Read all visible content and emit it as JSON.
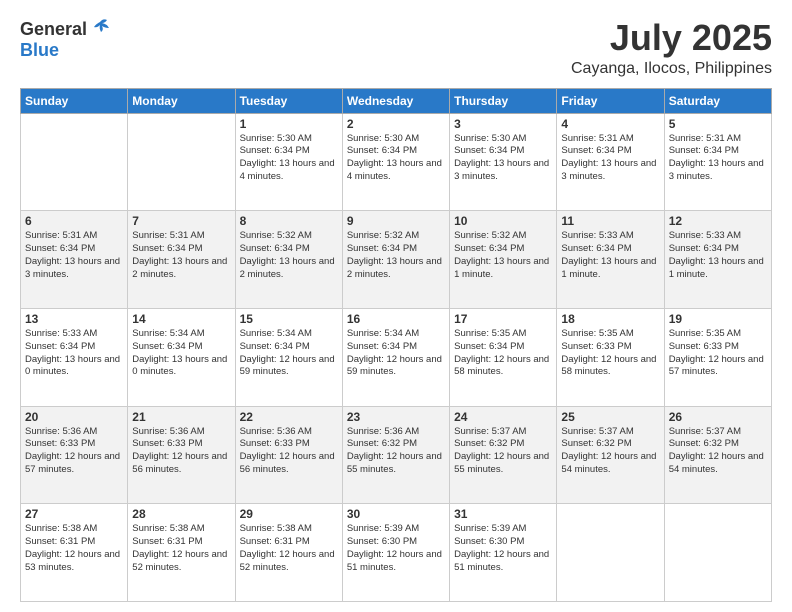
{
  "header": {
    "logo_general": "General",
    "logo_blue": "Blue",
    "month_title": "July 2025",
    "subtitle": "Cayanga, Ilocos, Philippines"
  },
  "weekdays": [
    "Sunday",
    "Monday",
    "Tuesday",
    "Wednesday",
    "Thursday",
    "Friday",
    "Saturday"
  ],
  "weeks": [
    [
      {
        "day": "",
        "info": ""
      },
      {
        "day": "",
        "info": ""
      },
      {
        "day": "1",
        "info": "Sunrise: 5:30 AM\nSunset: 6:34 PM\nDaylight: 13 hours and 4 minutes."
      },
      {
        "day": "2",
        "info": "Sunrise: 5:30 AM\nSunset: 6:34 PM\nDaylight: 13 hours and 4 minutes."
      },
      {
        "day": "3",
        "info": "Sunrise: 5:30 AM\nSunset: 6:34 PM\nDaylight: 13 hours and 3 minutes."
      },
      {
        "day": "4",
        "info": "Sunrise: 5:31 AM\nSunset: 6:34 PM\nDaylight: 13 hours and 3 minutes."
      },
      {
        "day": "5",
        "info": "Sunrise: 5:31 AM\nSunset: 6:34 PM\nDaylight: 13 hours and 3 minutes."
      }
    ],
    [
      {
        "day": "6",
        "info": "Sunrise: 5:31 AM\nSunset: 6:34 PM\nDaylight: 13 hours and 3 minutes."
      },
      {
        "day": "7",
        "info": "Sunrise: 5:31 AM\nSunset: 6:34 PM\nDaylight: 13 hours and 2 minutes."
      },
      {
        "day": "8",
        "info": "Sunrise: 5:32 AM\nSunset: 6:34 PM\nDaylight: 13 hours and 2 minutes."
      },
      {
        "day": "9",
        "info": "Sunrise: 5:32 AM\nSunset: 6:34 PM\nDaylight: 13 hours and 2 minutes."
      },
      {
        "day": "10",
        "info": "Sunrise: 5:32 AM\nSunset: 6:34 PM\nDaylight: 13 hours and 1 minute."
      },
      {
        "day": "11",
        "info": "Sunrise: 5:33 AM\nSunset: 6:34 PM\nDaylight: 13 hours and 1 minute."
      },
      {
        "day": "12",
        "info": "Sunrise: 5:33 AM\nSunset: 6:34 PM\nDaylight: 13 hours and 1 minute."
      }
    ],
    [
      {
        "day": "13",
        "info": "Sunrise: 5:33 AM\nSunset: 6:34 PM\nDaylight: 13 hours and 0 minutes."
      },
      {
        "day": "14",
        "info": "Sunrise: 5:34 AM\nSunset: 6:34 PM\nDaylight: 13 hours and 0 minutes."
      },
      {
        "day": "15",
        "info": "Sunrise: 5:34 AM\nSunset: 6:34 PM\nDaylight: 12 hours and 59 minutes."
      },
      {
        "day": "16",
        "info": "Sunrise: 5:34 AM\nSunset: 6:34 PM\nDaylight: 12 hours and 59 minutes."
      },
      {
        "day": "17",
        "info": "Sunrise: 5:35 AM\nSunset: 6:34 PM\nDaylight: 12 hours and 58 minutes."
      },
      {
        "day": "18",
        "info": "Sunrise: 5:35 AM\nSunset: 6:33 PM\nDaylight: 12 hours and 58 minutes."
      },
      {
        "day": "19",
        "info": "Sunrise: 5:35 AM\nSunset: 6:33 PM\nDaylight: 12 hours and 57 minutes."
      }
    ],
    [
      {
        "day": "20",
        "info": "Sunrise: 5:36 AM\nSunset: 6:33 PM\nDaylight: 12 hours and 57 minutes."
      },
      {
        "day": "21",
        "info": "Sunrise: 5:36 AM\nSunset: 6:33 PM\nDaylight: 12 hours and 56 minutes."
      },
      {
        "day": "22",
        "info": "Sunrise: 5:36 AM\nSunset: 6:33 PM\nDaylight: 12 hours and 56 minutes."
      },
      {
        "day": "23",
        "info": "Sunrise: 5:36 AM\nSunset: 6:32 PM\nDaylight: 12 hours and 55 minutes."
      },
      {
        "day": "24",
        "info": "Sunrise: 5:37 AM\nSunset: 6:32 PM\nDaylight: 12 hours and 55 minutes."
      },
      {
        "day": "25",
        "info": "Sunrise: 5:37 AM\nSunset: 6:32 PM\nDaylight: 12 hours and 54 minutes."
      },
      {
        "day": "26",
        "info": "Sunrise: 5:37 AM\nSunset: 6:32 PM\nDaylight: 12 hours and 54 minutes."
      }
    ],
    [
      {
        "day": "27",
        "info": "Sunrise: 5:38 AM\nSunset: 6:31 PM\nDaylight: 12 hours and 53 minutes."
      },
      {
        "day": "28",
        "info": "Sunrise: 5:38 AM\nSunset: 6:31 PM\nDaylight: 12 hours and 52 minutes."
      },
      {
        "day": "29",
        "info": "Sunrise: 5:38 AM\nSunset: 6:31 PM\nDaylight: 12 hours and 52 minutes."
      },
      {
        "day": "30",
        "info": "Sunrise: 5:39 AM\nSunset: 6:30 PM\nDaylight: 12 hours and 51 minutes."
      },
      {
        "day": "31",
        "info": "Sunrise: 5:39 AM\nSunset: 6:30 PM\nDaylight: 12 hours and 51 minutes."
      },
      {
        "day": "",
        "info": ""
      },
      {
        "day": "",
        "info": ""
      }
    ]
  ]
}
